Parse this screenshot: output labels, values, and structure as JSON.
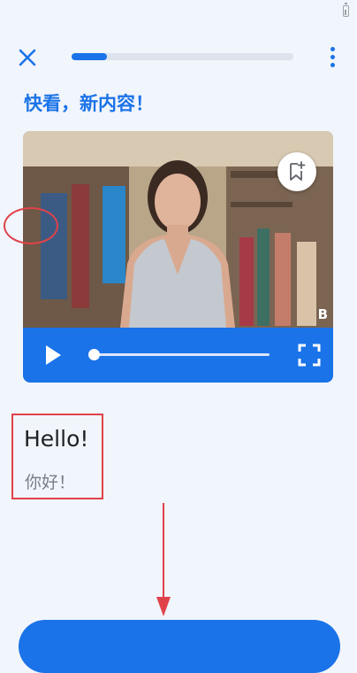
{
  "header": {
    "lesson_progress_percent": 16
  },
  "page_title": "快看，新内容！",
  "video": {
    "watermark": "B"
  },
  "phrase": {
    "english": "Hello!",
    "chinese": "你好！"
  },
  "colors": {
    "accent": "#1a73e8",
    "highlight": "#e0424a",
    "background": "#f1f5fc"
  },
  "icons": [
    "battery-icon",
    "close-icon",
    "more-vertical-icon",
    "bookmark-add-icon",
    "play-icon",
    "fullscreen-icon",
    "down-arrow-icon"
  ]
}
